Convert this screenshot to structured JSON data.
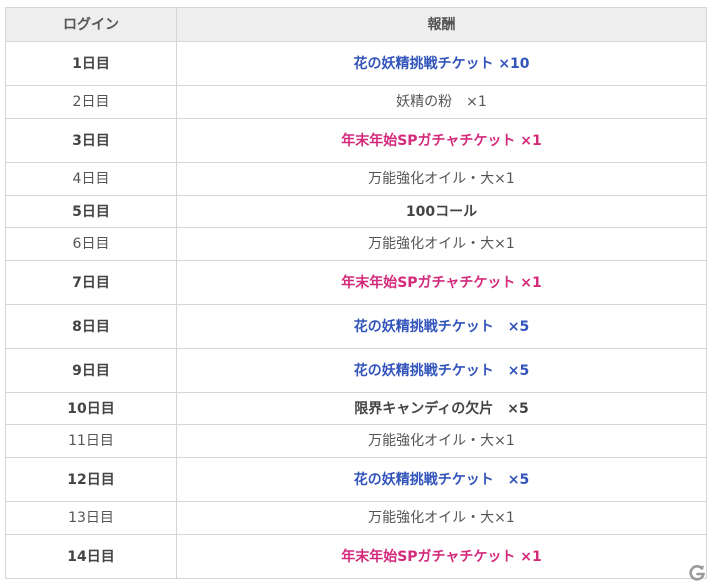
{
  "table": {
    "headers": [
      "ログイン",
      "報酬"
    ],
    "rows": [
      {
        "day": "1日目",
        "reward": "花の妖精挑戦チケット ×10",
        "style": "blue",
        "bold": true,
        "size": "tall"
      },
      {
        "day": "2日目",
        "reward": "妖精の粉　×1",
        "style": "plain",
        "bold": false,
        "size": "short"
      },
      {
        "day": "3日目",
        "reward": "年末年始SPガチャチケット ×1",
        "style": "pink",
        "bold": true,
        "size": "tall"
      },
      {
        "day": "4日目",
        "reward": "万能強化オイル・大×1",
        "style": "plain",
        "bold": false,
        "size": "short"
      },
      {
        "day": "5日目",
        "reward": "100コール",
        "style": "plainbold",
        "bold": true,
        "size": "mid"
      },
      {
        "day": "6日目",
        "reward": "万能強化オイル・大×1",
        "style": "plain",
        "bold": false,
        "size": "short"
      },
      {
        "day": "7日目",
        "reward": "年末年始SPガチャチケット ×1",
        "style": "pink",
        "bold": true,
        "size": "tall"
      },
      {
        "day": "8日目",
        "reward": "花の妖精挑戦チケット　×5",
        "style": "blue",
        "bold": true,
        "size": "tall"
      },
      {
        "day": "9日目",
        "reward": "花の妖精挑戦チケット　×5",
        "style": "blue",
        "bold": true,
        "size": "tall"
      },
      {
        "day": "10日目",
        "reward": "限界キャンディの欠片　×5",
        "style": "plainbold",
        "bold": true,
        "size": "mid"
      },
      {
        "day": "11日目",
        "reward": "万能強化オイル・大×1",
        "style": "plain",
        "bold": false,
        "size": "short"
      },
      {
        "day": "12日目",
        "reward": "花の妖精挑戦チケット　×5",
        "style": "blue",
        "bold": true,
        "size": "tall"
      },
      {
        "day": "13日目",
        "reward": "万能強化オイル・大×1",
        "style": "plain",
        "bold": false,
        "size": "short"
      },
      {
        "day": "14日目",
        "reward": "年末年始SPガチャチケット ×1",
        "style": "pink",
        "bold": true,
        "size": "tall"
      }
    ]
  },
  "colors": {
    "blue": "#3355bb",
    "pink": "#d42a7c",
    "header_bg": "#eeeeee",
    "border": "#d6d6d6"
  },
  "watermark": {
    "icon": "gamer-logo-icon"
  }
}
